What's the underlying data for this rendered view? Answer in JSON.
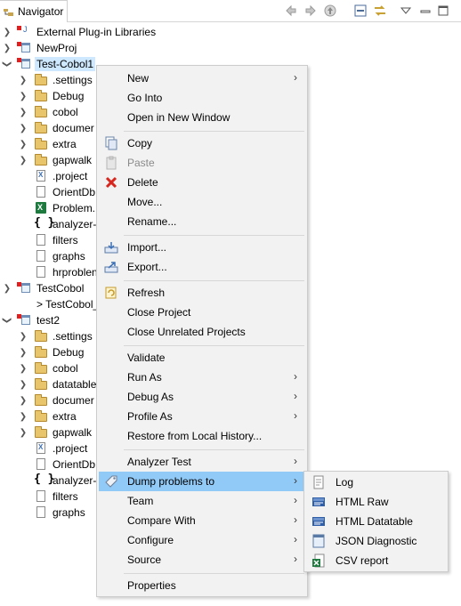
{
  "view": {
    "tab_label": "Navigator"
  },
  "tree": {
    "items": [
      {
        "label": "External Plug-in Libraries"
      },
      {
        "label": "NewProj"
      },
      {
        "label": "Test-Cobol1"
      },
      {
        "label": ".settings"
      },
      {
        "label": "Debug"
      },
      {
        "label": "cobol"
      },
      {
        "label": "documer"
      },
      {
        "label": "extra"
      },
      {
        "label": "gapwalk"
      },
      {
        "label": ".project"
      },
      {
        "label": "OrientDb"
      },
      {
        "label": "Problem."
      },
      {
        "label": "analyzer-"
      },
      {
        "label": "filters"
      },
      {
        "label": "graphs"
      },
      {
        "label": "hrproblen"
      },
      {
        "label": "TestCobol"
      },
      {
        "label": "> TestCobol_"
      },
      {
        "label": "test2"
      },
      {
        "label": ".settings"
      },
      {
        "label": "Debug"
      },
      {
        "label": "cobol"
      },
      {
        "label": "datatable"
      },
      {
        "label": "documer"
      },
      {
        "label": "extra"
      },
      {
        "label": "gapwalk"
      },
      {
        "label": ".project"
      },
      {
        "label": "OrientDb"
      },
      {
        "label": "analyzer-"
      },
      {
        "label": "filters"
      },
      {
        "label": "graphs"
      }
    ]
  },
  "context_menu": {
    "items": [
      {
        "label": "New"
      },
      {
        "label": "Go Into"
      },
      {
        "label": "Open in New Window"
      },
      {
        "label": "Copy"
      },
      {
        "label": "Paste"
      },
      {
        "label": "Delete"
      },
      {
        "label": "Move..."
      },
      {
        "label": "Rename..."
      },
      {
        "label": "Import..."
      },
      {
        "label": "Export..."
      },
      {
        "label": "Refresh"
      },
      {
        "label": "Close Project"
      },
      {
        "label": "Close Unrelated Projects"
      },
      {
        "label": "Validate"
      },
      {
        "label": "Run As"
      },
      {
        "label": "Debug As"
      },
      {
        "label": "Profile As"
      },
      {
        "label": "Restore from Local History..."
      },
      {
        "label": "Analyzer Test"
      },
      {
        "label": "Dump problems to"
      },
      {
        "label": "Team"
      },
      {
        "label": "Compare With"
      },
      {
        "label": "Configure"
      },
      {
        "label": "Source"
      },
      {
        "label": "Properties"
      }
    ],
    "arrow_glyph": "›"
  },
  "submenu": {
    "items": [
      {
        "label": "Log"
      },
      {
        "label": "HTML Raw"
      },
      {
        "label": "HTML Datatable"
      },
      {
        "label": "JSON Diagnostic"
      },
      {
        "label": "CSV report"
      }
    ]
  },
  "colors": {
    "highlight": "#91c9f7",
    "selection": "#cde8ff",
    "menu_background": "#f2f2f2"
  }
}
